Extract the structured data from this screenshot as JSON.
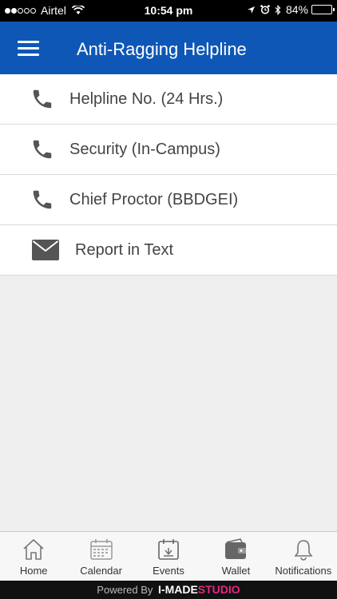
{
  "status_bar": {
    "carrier": "Airtel",
    "time": "10:54 pm",
    "battery": "84%",
    "battery_level": 0.84
  },
  "header": {
    "title": "Anti-Ragging Helpline"
  },
  "list": [
    {
      "label": "Helpline No. (24 Hrs.)",
      "icon": "phone-icon"
    },
    {
      "label": "Security (In-Campus)",
      "icon": "phone-icon"
    },
    {
      "label": "Chief Proctor (BBDGEI)",
      "icon": "phone-icon"
    },
    {
      "label": "Report in Text",
      "icon": "envelope-icon"
    }
  ],
  "tabs": [
    {
      "label": "Home",
      "icon": "home-icon"
    },
    {
      "label": "Calendar",
      "icon": "calendar-icon"
    },
    {
      "label": "Events",
      "icon": "events-icon"
    },
    {
      "label": "Wallet",
      "icon": "wallet-icon"
    },
    {
      "label": "Notifications",
      "icon": "bell-icon"
    }
  ],
  "footer": {
    "powered_by": "Powered By",
    "brand": "I-MADE",
    "brand_accent": "STUDIO"
  },
  "colors": {
    "header": "#0e57b6",
    "accent": "#e02a7d",
    "icon": "#555555"
  }
}
